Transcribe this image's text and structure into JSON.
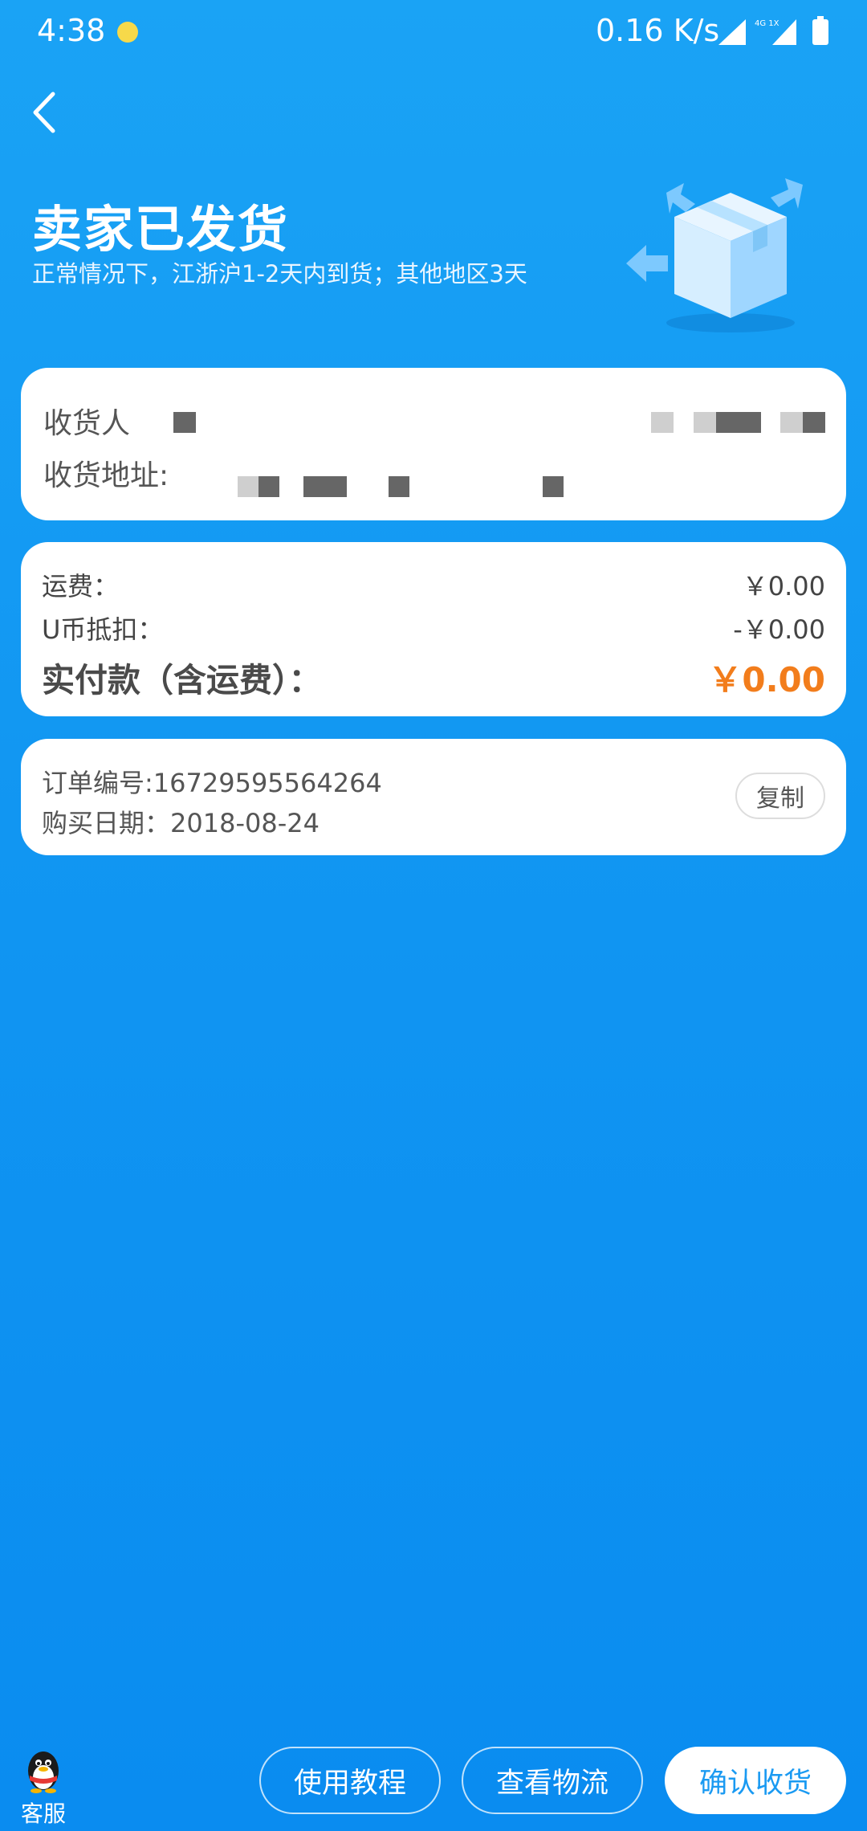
{
  "status_bar": {
    "time": "4:38",
    "speed": "0.16 K/s",
    "network": "4G 1X"
  },
  "header": {
    "title": "卖家已发货",
    "subtitle": "正常情况下，江浙沪1-2天内到货；其他地区3天"
  },
  "address": {
    "receiver_label": "收货人",
    "address_label": "收货地址:"
  },
  "fees": {
    "shipping_label": "运费：",
    "shipping_value": "￥0.00",
    "ucoin_label": "U币抵扣：",
    "ucoin_value": "-￥0.00",
    "total_label": "实付款（含运费）：",
    "total_value": "￥0.00"
  },
  "order": {
    "number": "订单编号:16729595564264",
    "date": "购买日期：2018-08-24",
    "copy_label": "复制"
  },
  "bottom": {
    "service_label": "客服",
    "tutorial_label": "使用教程",
    "logistics_label": "查看物流",
    "confirm_label": "确认收货"
  },
  "colors": {
    "background": "#1196f2",
    "total_amount": "#f27d1c",
    "confirm_text": "#1a9af2"
  },
  "icons": [
    "back-arrow-icon",
    "package-box-icon",
    "qq-penguin-icon",
    "signal-icon",
    "battery-icon"
  ]
}
